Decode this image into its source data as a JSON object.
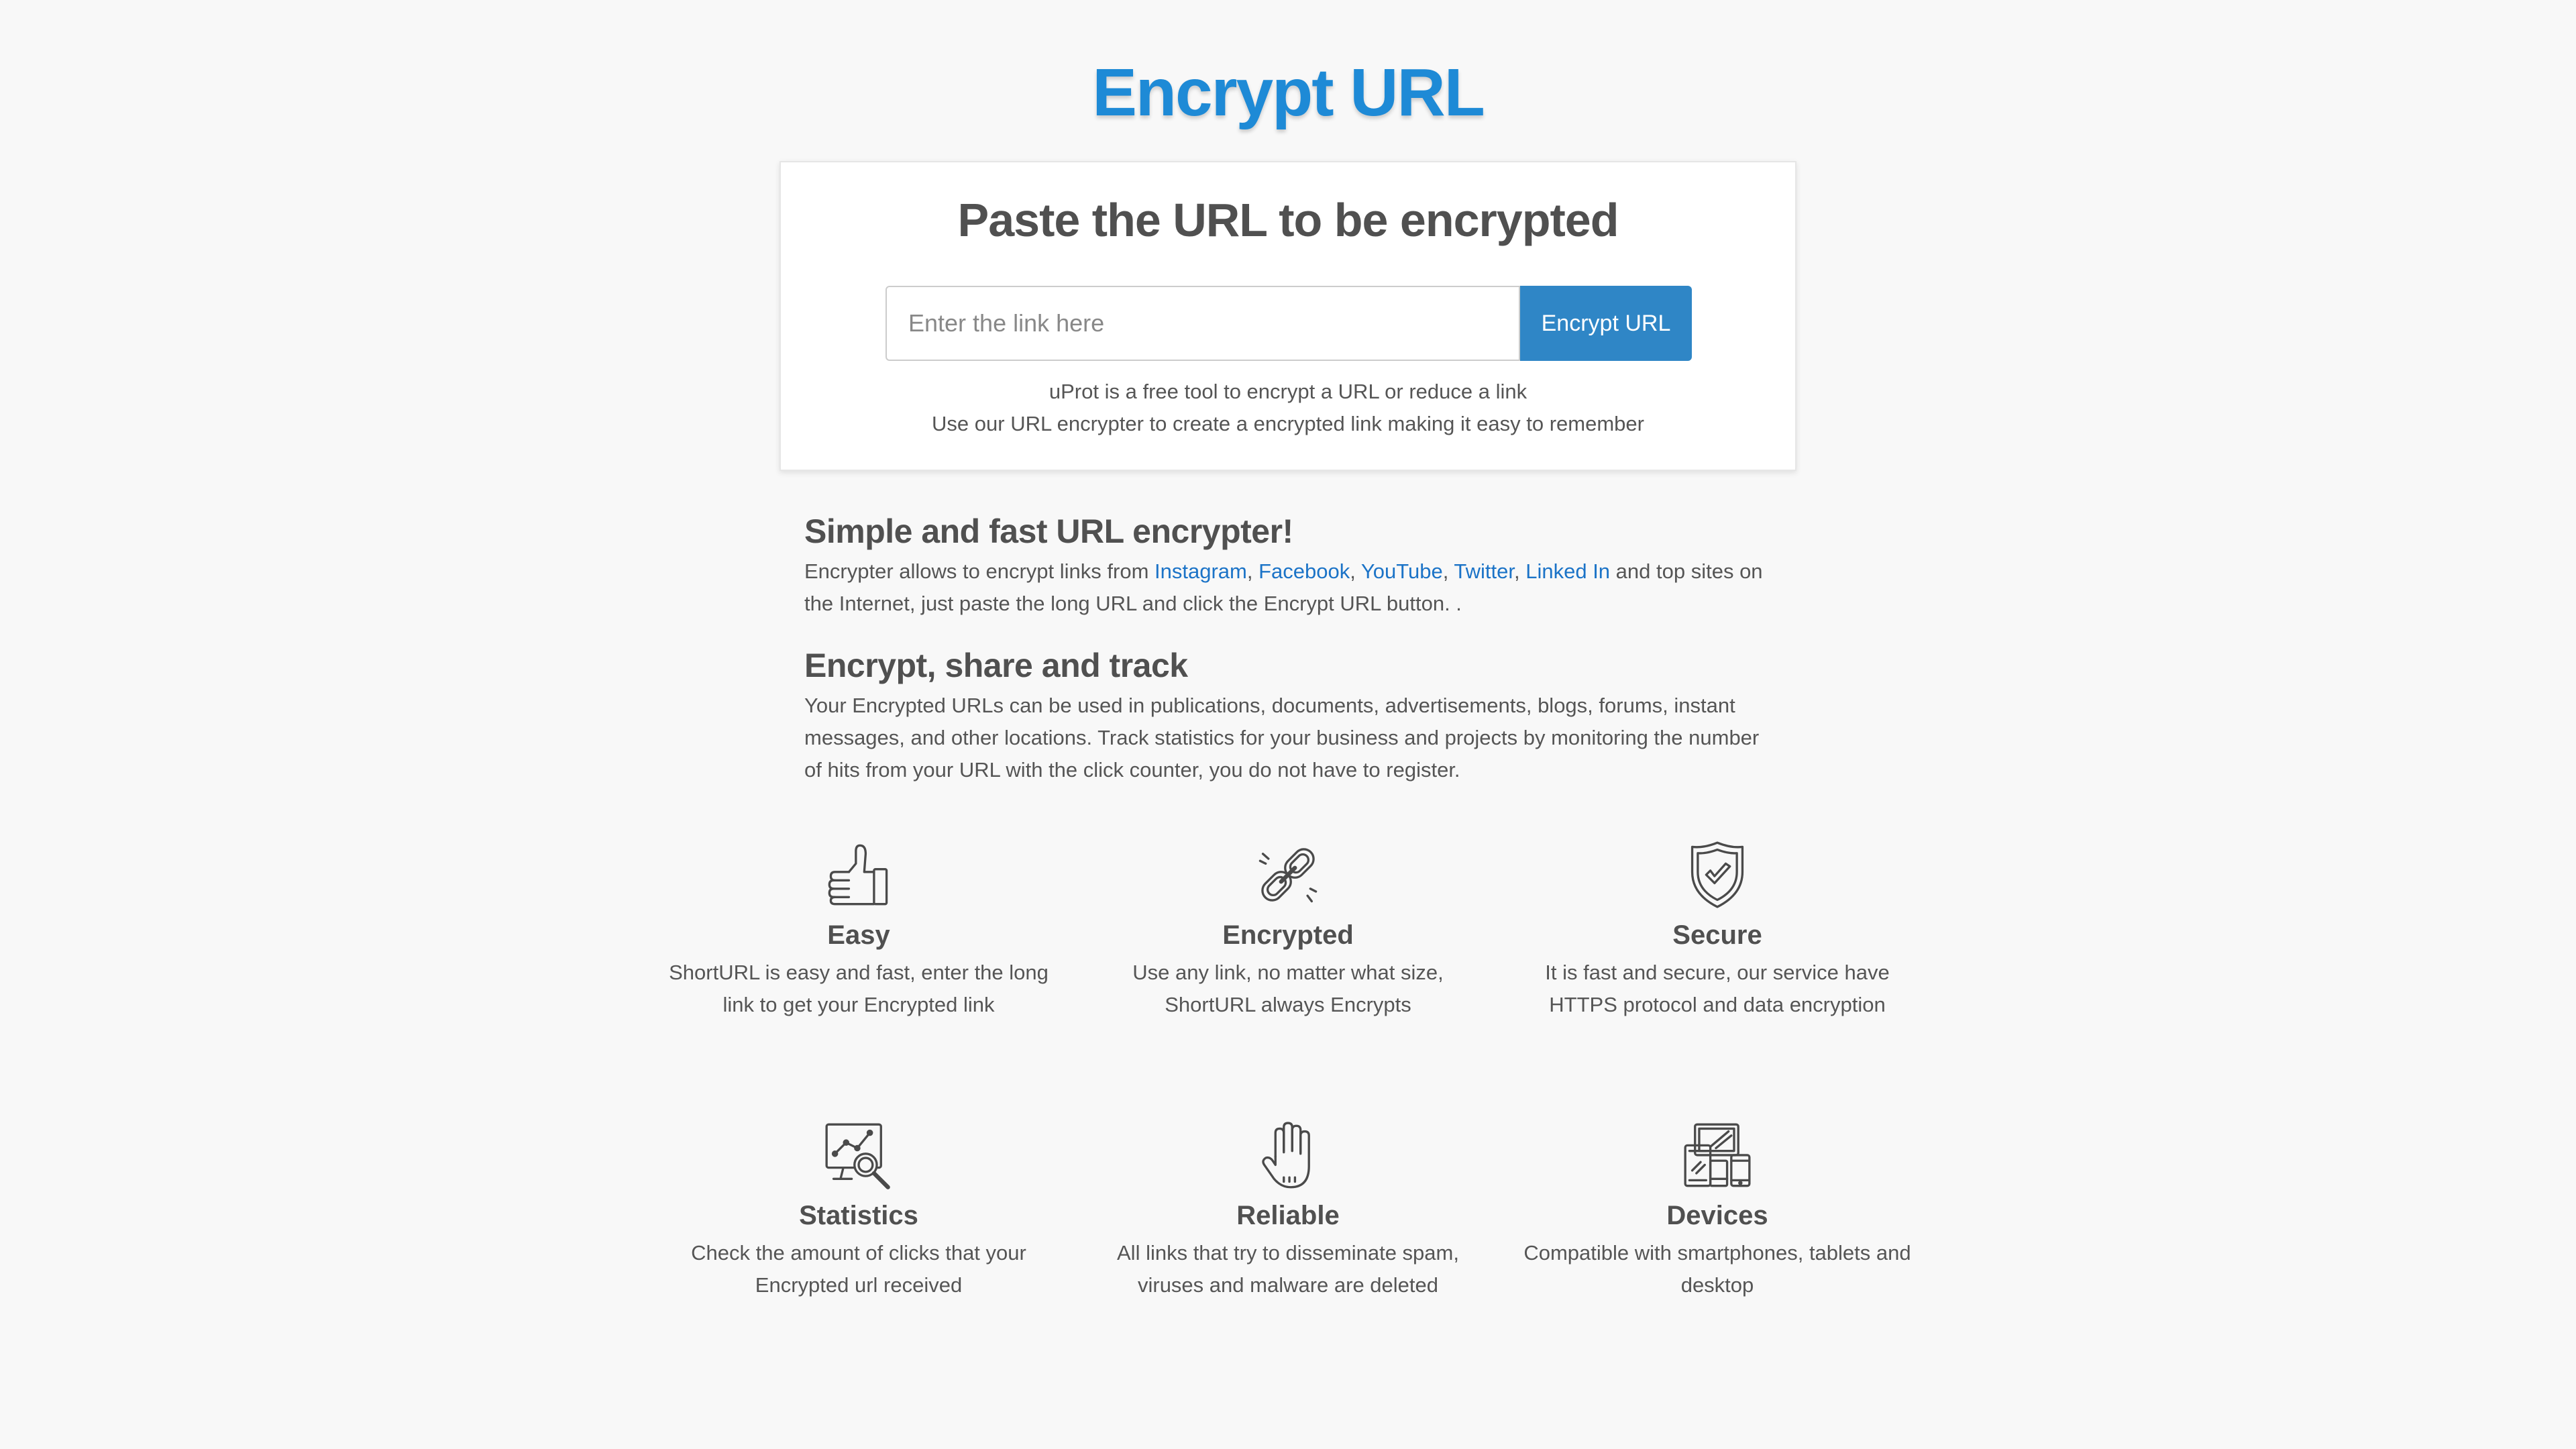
{
  "header": {
    "logo_text": "Encrypt URL"
  },
  "encrypt_card": {
    "title": "Paste the URL to be encrypted",
    "input_placeholder": "Enter the link here",
    "input_value": "",
    "button_label": "Encrypt URL",
    "line1": "uProt is a free tool to encrypt a URL or reduce a link",
    "line2": "Use our URL encrypter to create a encrypted link making it easy to remember"
  },
  "section_simple": {
    "heading": "Simple and fast URL encrypter!",
    "text_before": "Encrypter allows to encrypt links from ",
    "links": [
      "Instagram",
      "Facebook",
      "YouTube",
      "Twitter",
      "Linked In"
    ],
    "separator": ", ",
    "text_after": " and top sites on the Internet, just paste the long URL and click the Encrypt URL button. ."
  },
  "section_track": {
    "heading": "Encrypt, share and track",
    "text": "Your Encrypted URLs can be used in publications, documents, advertisements, blogs, forums, instant messages, and other locations. Track statistics for your business and projects by monitoring the number of hits from your URL with the click counter, you do not have to register."
  },
  "features": [
    {
      "icon": "thumbs-up-icon",
      "title": "Easy",
      "desc": "ShortURL is easy and fast, enter the long link to get your Encrypted link"
    },
    {
      "icon": "chain-link-icon",
      "title": "Encrypted",
      "desc": "Use any link, no matter what size, ShortURL always Encrypts"
    },
    {
      "icon": "shield-check-icon",
      "title": "Secure",
      "desc": "It is fast and secure, our service have HTTPS protocol and data encryption"
    },
    {
      "icon": "chart-magnifier-icon",
      "title": "Statistics",
      "desc": "Check the amount of clicks that your Encrypted url received"
    },
    {
      "icon": "hand-stop-icon",
      "title": "Reliable",
      "desc": "All links that try to disseminate spam, viruses and malware are deleted"
    },
    {
      "icon": "devices-icon",
      "title": "Devices",
      "desc": "Compatible with smartphones, tablets and desktop"
    }
  ],
  "colors": {
    "brand_blue": "#1e8ad6",
    "button_blue": "#2f86c6",
    "link_blue": "#1b73c7",
    "background": "#f8f8f8",
    "text": "#555555",
    "heading": "#505050"
  }
}
